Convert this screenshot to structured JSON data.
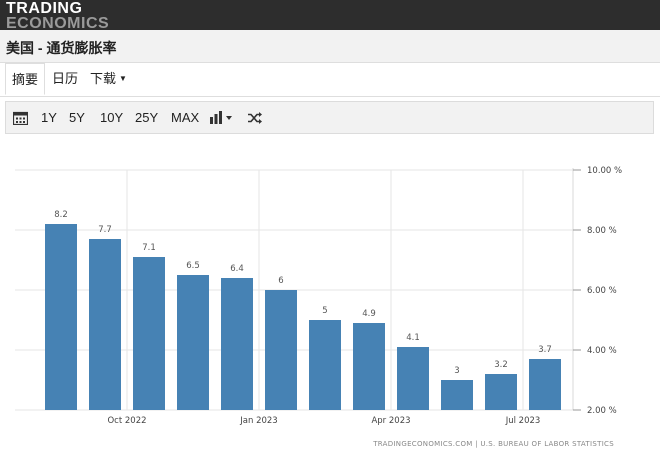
{
  "header": {
    "logo_line1": "TRADING",
    "logo_line2": "ECONOMICS"
  },
  "page": {
    "title": "美国 - 通货膨胀率"
  },
  "tabs": [
    {
      "label": "摘要",
      "active": true
    },
    {
      "label": "日历",
      "active": false
    },
    {
      "label": "下载",
      "active": false,
      "dropdown": true
    }
  ],
  "toolbar": {
    "calendar_icon": "calendar-icon",
    "ranges": [
      "1Y",
      "5Y",
      "10Y",
      "25Y",
      "MAX"
    ],
    "chart_type_icon": "bar-chart-icon",
    "shuffle_icon": "shuffle-icon"
  },
  "colors": {
    "bar": "#4682b4",
    "topbar": "#2d2d2d",
    "grid": "#e6e6e6"
  },
  "chart_data": {
    "type": "bar",
    "values": [
      8.2,
      7.7,
      7.1,
      6.5,
      6.4,
      6,
      5,
      4.9,
      4.1,
      3,
      3.2,
      3.7
    ],
    "value_labels": [
      "8.2",
      "7.7",
      "7.1",
      "6.5",
      "6.4",
      "6",
      "5",
      "4.9",
      "4.1",
      "3",
      "3.2",
      "3.7"
    ],
    "x_tick_labels": [
      {
        "label": "Oct 2022",
        "bar_index": 1.5
      },
      {
        "label": "Jan 2023",
        "bar_index": 4.5
      },
      {
        "label": "Apr 2023",
        "bar_index": 7.5
      },
      {
        "label": "Jul 2023",
        "bar_index": 10.5
      }
    ],
    "y_ticks": [
      10,
      8,
      6,
      4,
      2
    ],
    "y_tick_labels": [
      "10.00 %",
      "8.00 %",
      "6.00 %",
      "4.00 %",
      "2.00 %"
    ],
    "ylim": [
      2,
      10
    ],
    "y_axis_side": "right",
    "grid": true,
    "source": "TRADINGECONOMICS.COM | U.S. BUREAU OF LABOR STATISTICS"
  }
}
